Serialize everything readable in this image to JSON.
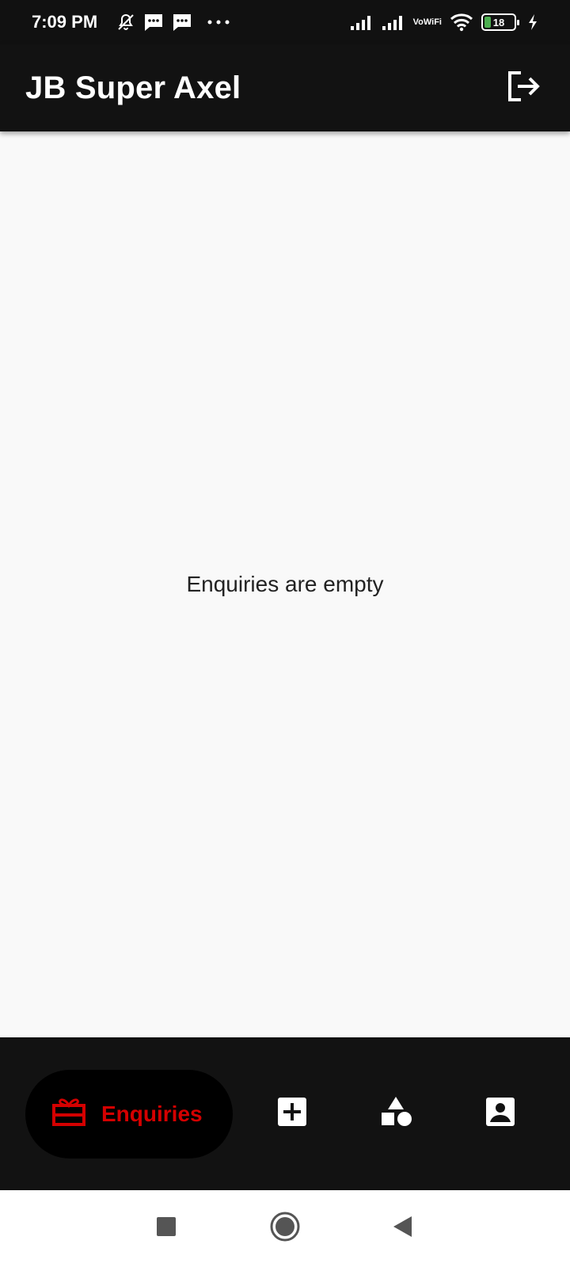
{
  "status_bar": {
    "time": "7:09 PM",
    "icons_left": [
      "mute-bell-icon",
      "message-icon",
      "message-icon",
      "more-dots-icon"
    ],
    "icons_right": [
      "signal-icon",
      "signal-icon",
      "vowifi-icon",
      "wifi-icon",
      "battery-icon",
      "charging-icon"
    ],
    "vowifi_line1": "Vo",
    "vowifi_line2": "WiFi",
    "battery_level": "18"
  },
  "app_bar": {
    "title": "JB Super Axel",
    "action_icon": "logout-icon"
  },
  "content": {
    "empty_message": "Enquiries are empty"
  },
  "bottom_nav": {
    "active": {
      "label": "Enquiries",
      "icon": "enquiries-icon",
      "color": "#d40000"
    },
    "items": [
      {
        "name": "add",
        "icon": "add-box-icon"
      },
      {
        "name": "categories",
        "icon": "shapes-icon"
      },
      {
        "name": "profile",
        "icon": "account-box-icon"
      }
    ]
  },
  "system_nav": {
    "buttons": [
      "recents-square",
      "home-circle",
      "back-triangle"
    ]
  },
  "colors": {
    "bar_background": "#121212",
    "accent": "#d40000",
    "content_background": "#f9f9f9"
  }
}
